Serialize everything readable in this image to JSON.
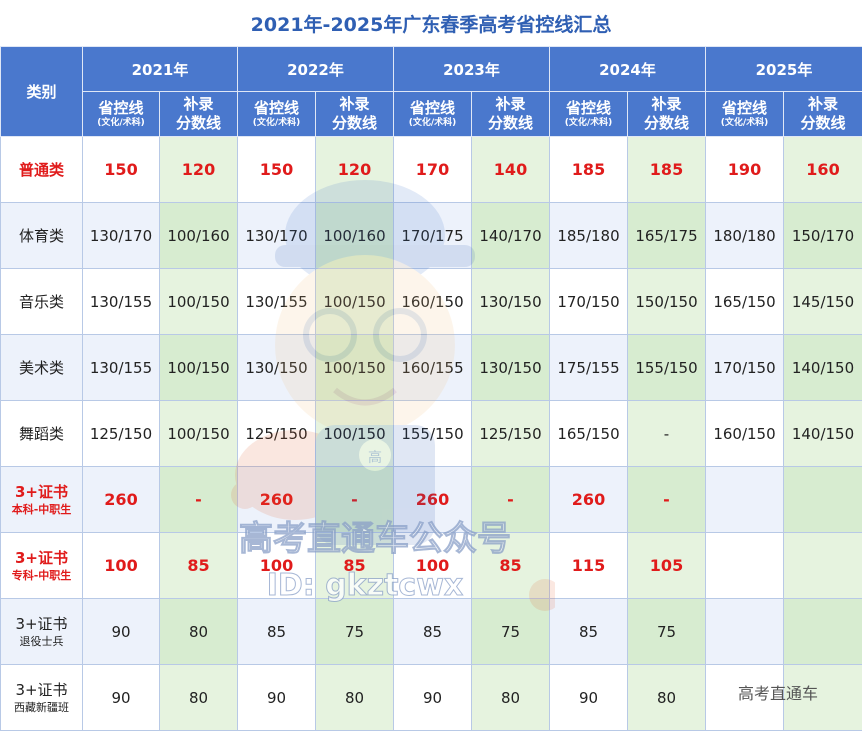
{
  "title": "2021年-2025年广东春季高考省控线汇总",
  "header": {
    "category_label": "类别",
    "years": [
      "2021年",
      "2022年",
      "2023年",
      "2024年",
      "2025年"
    ],
    "provincial_label": "省控线",
    "provincial_note": "(文化/术科)",
    "supplement_label_line1": "补录",
    "supplement_label_line2": "分数线"
  },
  "rows": [
    {
      "cat1": "普通类",
      "cat2": "",
      "emph": true,
      "cells": [
        "150",
        "120",
        "150",
        "120",
        "170",
        "140",
        "185",
        "185",
        "190",
        "160"
      ]
    },
    {
      "cat1": "体育类",
      "cat2": "",
      "emph": false,
      "cells": [
        "130/170",
        "100/160",
        "130/170",
        "100/160",
        "170/175",
        "140/170",
        "185/180",
        "165/175",
        "180/180",
        "150/170"
      ]
    },
    {
      "cat1": "音乐类",
      "cat2": "",
      "emph": false,
      "cells": [
        "130/155",
        "100/150",
        "130/155",
        "100/150",
        "160/150",
        "130/150",
        "170/150",
        "150/150",
        "165/150",
        "145/150"
      ]
    },
    {
      "cat1": "美术类",
      "cat2": "",
      "emph": false,
      "cells": [
        "130/155",
        "100/150",
        "130/150",
        "100/150",
        "160/155",
        "130/150",
        "175/155",
        "155/150",
        "170/150",
        "140/150"
      ]
    },
    {
      "cat1": "舞蹈类",
      "cat2": "",
      "emph": false,
      "cells": [
        "125/150",
        "100/150",
        "125/150",
        "100/150",
        "155/150",
        "125/150",
        "165/150",
        "-",
        "160/150",
        "140/150"
      ]
    },
    {
      "cat1": "3+证书",
      "cat2": "本科-中职生",
      "emph": true,
      "cells": [
        "260",
        "-",
        "260",
        "-",
        "260",
        "-",
        "260",
        "-",
        "",
        ""
      ]
    },
    {
      "cat1": "3+证书",
      "cat2": "专科-中职生",
      "emph": true,
      "cells": [
        "100",
        "85",
        "100",
        "85",
        "100",
        "85",
        "115",
        "105",
        "",
        ""
      ]
    },
    {
      "cat1": "3+证书",
      "cat2": "退役士兵",
      "emph": false,
      "cells": [
        "90",
        "80",
        "85",
        "75",
        "85",
        "75",
        "85",
        "75",
        "",
        ""
      ]
    },
    {
      "cat1": "3+证书",
      "cat2": "西藏新疆班",
      "emph": false,
      "cells": [
        "90",
        "80",
        "90",
        "80",
        "90",
        "80",
        "90",
        "80",
        "",
        ""
      ]
    }
  ],
  "watermark": {
    "text_main": "高考直通车公众号",
    "text_id": "ID: gkztcwx",
    "badge_char": "高",
    "corner_text": "高考直通车"
  },
  "colors": {
    "header_blue": "#4a78cd",
    "title_blue": "#2f5fb3",
    "emphasis_red": "#e01b1b",
    "supplement_green": "#e6f3df",
    "row_alt_blue": "#edf2fb"
  }
}
